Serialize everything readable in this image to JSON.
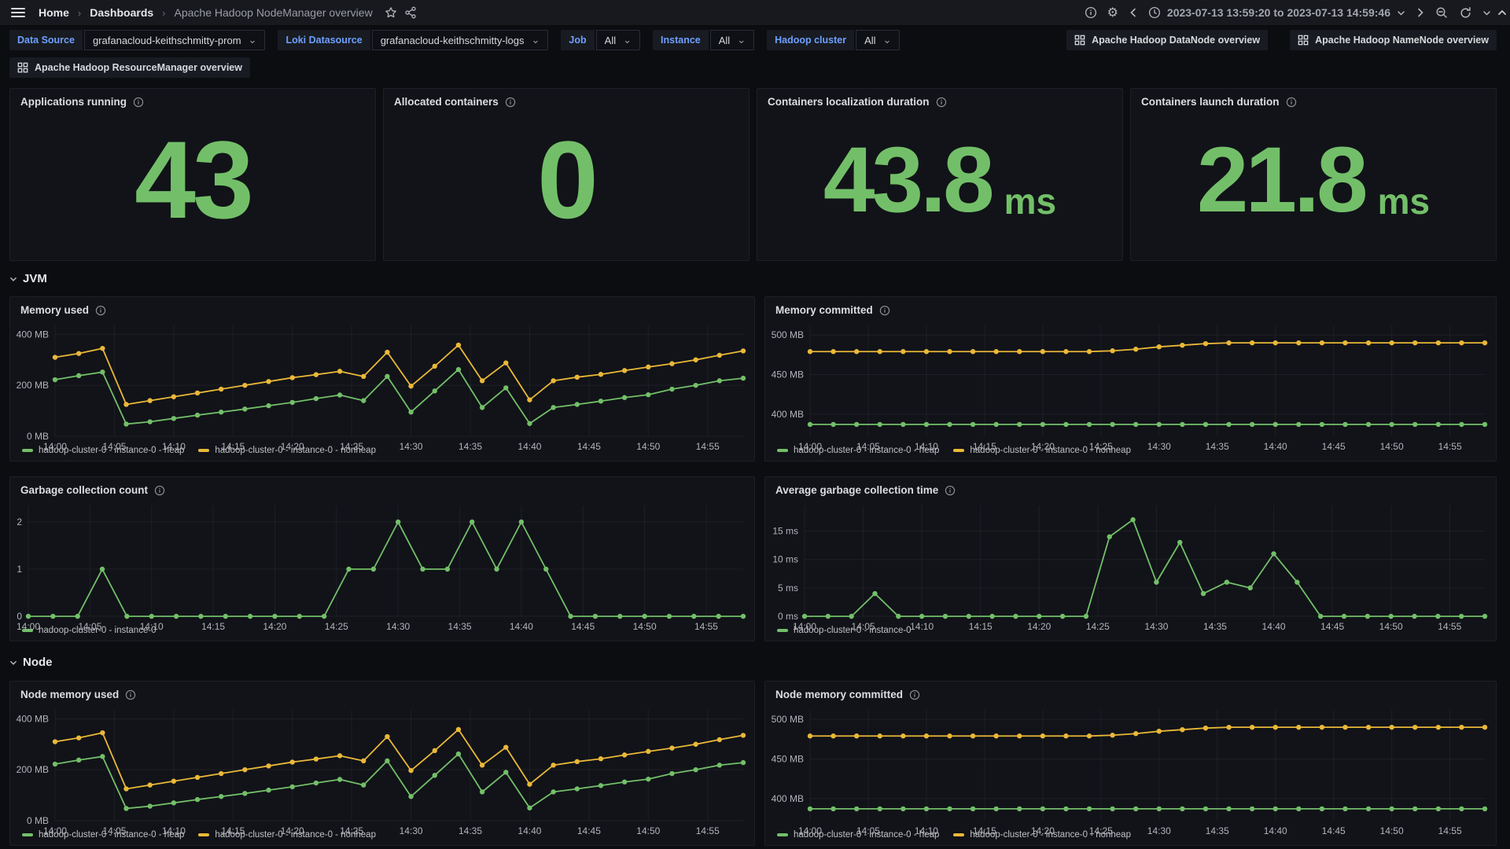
{
  "nav": {
    "breadcrumb": [
      "Home",
      "Dashboards",
      "Apache Hadoop NodeManager overview"
    ],
    "time_range": "2023-07-13 13:59:20 to 2023-07-13 14:59:46"
  },
  "filters": [
    {
      "label": "Data Source",
      "value": "grafanacloud-keithschmitty-prom"
    },
    {
      "label": "Loki Datasource",
      "value": "grafanacloud-keithschmitty-logs"
    },
    {
      "label": "Job",
      "value": "All"
    },
    {
      "label": "Instance",
      "value": "All"
    },
    {
      "label": "Hadoop cluster",
      "value": "All"
    }
  ],
  "dashboard_links": {
    "row1": [
      "Apache Hadoop DataNode overview",
      "Apache Hadoop NameNode overview"
    ],
    "row2": [
      "Apache Hadoop ResourceManager overview"
    ]
  },
  "stats": [
    {
      "title": "Applications running",
      "value": "43",
      "unit": ""
    },
    {
      "title": "Allocated containers",
      "value": "0",
      "unit": ""
    },
    {
      "title": "Containers localization duration",
      "value": "43.8",
      "unit": "ms"
    },
    {
      "title": "Containers launch duration",
      "value": "21.8",
      "unit": "ms"
    }
  ],
  "sections": {
    "jvm": "JVM",
    "node": "Node"
  },
  "colors": {
    "green": "#73BF69",
    "yellow": "#EAB839",
    "stat_value": "#73BF69",
    "grid": "rgba(204,204,220,0.07)",
    "tick_text": "#b2b4bb"
  },
  "chart_data": {
    "x_times": [
      "14:00",
      "14:02",
      "14:04",
      "14:06",
      "14:08",
      "14:10",
      "14:12",
      "14:14",
      "14:16",
      "14:18",
      "14:20",
      "14:22",
      "14:24",
      "14:26",
      "14:28",
      "14:30",
      "14:32",
      "14:34",
      "14:36",
      "14:38",
      "14:40",
      "14:42",
      "14:44",
      "14:46",
      "14:48",
      "14:50",
      "14:52",
      "14:54",
      "14:56",
      "14:58"
    ],
    "x_range_minutes": [
      0,
      58
    ],
    "xticks": [
      {
        "minute": 0,
        "label": "14:00"
      },
      {
        "minute": 5,
        "label": "14:05"
      },
      {
        "minute": 10,
        "label": "14:10"
      },
      {
        "minute": 15,
        "label": "14:15"
      },
      {
        "minute": 20,
        "label": "14:20"
      },
      {
        "minute": 25,
        "label": "14:25"
      },
      {
        "minute": 30,
        "label": "14:30"
      },
      {
        "minute": 35,
        "label": "14:35"
      },
      {
        "minute": 40,
        "label": "14:40"
      },
      {
        "minute": 45,
        "label": "14:45"
      },
      {
        "minute": 50,
        "label": "14:50"
      },
      {
        "minute": 55,
        "label": "14:55"
      }
    ],
    "charts": [
      {
        "id": "memory-used",
        "type": "line",
        "title": "Memory used",
        "unit": "MB",
        "ylim": [
          0,
          435
        ],
        "yticks": [
          {
            "value": 0,
            "label": "0 MB"
          },
          {
            "value": 200,
            "label": "200 MB"
          },
          {
            "value": 400,
            "label": "400 MB"
          }
        ],
        "series": [
          {
            "name": "hadoop-cluster-0 - instance-0 - heap",
            "color": "#73BF69",
            "values": [
              222,
              238,
              252,
              48,
              57,
              70,
              83,
              95,
              107,
              120,
              133,
              148,
              162,
              140,
              235,
              95,
              178,
              262,
              113,
              190,
              50,
              113,
              125,
              138,
              152,
              163,
              185,
              200,
              218,
              228
            ]
          },
          {
            "name": "hadoop-cluster-0 - instance-0 - nonheap",
            "color": "#EAB839",
            "values": [
              310,
              325,
              345,
              125,
              140,
              155,
              170,
              185,
              200,
              215,
              230,
              242,
              255,
              235,
              330,
              197,
              275,
              358,
              218,
              288,
              143,
              218,
              232,
              243,
              258,
              272,
              285,
              300,
              318,
              335
            ]
          }
        ]
      },
      {
        "id": "memory-committed",
        "type": "line",
        "title": "Memory committed",
        "unit": "MB",
        "ylim": [
          372,
          512
        ],
        "yticks": [
          {
            "value": 400,
            "label": "400 MB"
          },
          {
            "value": 450,
            "label": "450 MB"
          },
          {
            "value": 500,
            "label": "500 MB"
          }
        ],
        "series": [
          {
            "name": "hadoop-cluster-0 - instance-0 - heap",
            "color": "#73BF69",
            "values": [
              387,
              387,
              387,
              387,
              387,
              387,
              387,
              387,
              387,
              387,
              387,
              387,
              387,
              387,
              387,
              387,
              387,
              387,
              387,
              387,
              387,
              387,
              387,
              387,
              387,
              387,
              387,
              387,
              387,
              387
            ]
          },
          {
            "name": "hadoop-cluster-0 - instance-0 - nonheap",
            "color": "#EAB839",
            "values": [
              479,
              479,
              479,
              479,
              479,
              479,
              479,
              479,
              479,
              479,
              479,
              479,
              479,
              480,
              482,
              485,
              487,
              489,
              490,
              490,
              490,
              490,
              490,
              490,
              490,
              490,
              490,
              490,
              490,
              490
            ]
          }
        ]
      },
      {
        "id": "garbage-collection-count",
        "type": "line",
        "title": "Garbage collection count",
        "unit": "",
        "ylim": [
          0,
          2.35
        ],
        "yticks": [
          {
            "value": 0,
            "label": "0"
          },
          {
            "value": 1,
            "label": "1"
          },
          {
            "value": 2,
            "label": "2"
          }
        ],
        "series": [
          {
            "name": "hadoop-cluster-0 - instance-0",
            "color": "#73BF69",
            "values": [
              0,
              0,
              0,
              1,
              0,
              0,
              0,
              0,
              0,
              0,
              0,
              0,
              0,
              1,
              1,
              2,
              1,
              1,
              2,
              1,
              2,
              1,
              0,
              0,
              0,
              0,
              0,
              0,
              0,
              0
            ]
          }
        ]
      },
      {
        "id": "average-garbage-collection-time",
        "type": "line",
        "title": "Average garbage collection time",
        "unit": "ms",
        "ylim": [
          0,
          19.5
        ],
        "yticks": [
          {
            "value": 0,
            "label": "0 ms"
          },
          {
            "value": 5,
            "label": "5 ms"
          },
          {
            "value": 10,
            "label": "10 ms"
          },
          {
            "value": 15,
            "label": "15 ms"
          }
        ],
        "series": [
          {
            "name": "hadoop-cluster-0 - instance-0",
            "color": "#73BF69",
            "values": [
              0,
              0,
              0,
              4,
              0,
              0,
              0,
              0,
              0,
              0,
              0,
              0,
              0,
              14,
              17,
              6,
              13,
              4,
              6,
              5,
              11,
              6,
              0,
              0,
              0,
              0,
              0,
              0,
              0,
              0
            ]
          }
        ]
      },
      {
        "id": "node-memory-used",
        "type": "line",
        "title": "Node memory used",
        "unit": "MB",
        "ylim": [
          0,
          435
        ],
        "yticks": [
          {
            "value": 0,
            "label": "0 MB"
          },
          {
            "value": 200,
            "label": "200 MB"
          },
          {
            "value": 400,
            "label": "400 MB"
          }
        ],
        "series": [
          {
            "name": "hadoop-cluster-0 - instance-0 - heap",
            "color": "#73BF69",
            "values": [
              222,
              238,
              252,
              48,
              57,
              70,
              83,
              95,
              107,
              120,
              133,
              148,
              162,
              140,
              235,
              95,
              178,
              262,
              113,
              190,
              50,
              113,
              125,
              138,
              152,
              163,
              185,
              200,
              218,
              228
            ]
          },
          {
            "name": "hadoop-cluster-0 - instance-0 - nonheap",
            "color": "#EAB839",
            "values": [
              310,
              325,
              345,
              125,
              140,
              155,
              170,
              185,
              200,
              215,
              230,
              242,
              255,
              235,
              330,
              197,
              275,
              358,
              218,
              288,
              143,
              218,
              232,
              243,
              258,
              272,
              285,
              300,
              318,
              335
            ]
          }
        ]
      },
      {
        "id": "node-memory-committed",
        "type": "line",
        "title": "Node memory committed",
        "unit": "MB",
        "ylim": [
          372,
          512
        ],
        "yticks": [
          {
            "value": 400,
            "label": "400 MB"
          },
          {
            "value": 450,
            "label": "450 MB"
          },
          {
            "value": 500,
            "label": "500 MB"
          }
        ],
        "series": [
          {
            "name": "hadoop-cluster-0 - instance-0 - heap",
            "color": "#73BF69",
            "values": [
              387,
              387,
              387,
              387,
              387,
              387,
              387,
              387,
              387,
              387,
              387,
              387,
              387,
              387,
              387,
              387,
              387,
              387,
              387,
              387,
              387,
              387,
              387,
              387,
              387,
              387,
              387,
              387,
              387,
              387
            ]
          },
          {
            "name": "hadoop-cluster-0 - instance-0 - nonheap",
            "color": "#EAB839",
            "values": [
              479,
              479,
              479,
              479,
              479,
              479,
              479,
              479,
              479,
              479,
              479,
              479,
              479,
              480,
              482,
              485,
              487,
              489,
              490,
              490,
              490,
              490,
              490,
              490,
              490,
              490,
              490,
              490,
              490,
              490
            ]
          }
        ]
      }
    ]
  }
}
